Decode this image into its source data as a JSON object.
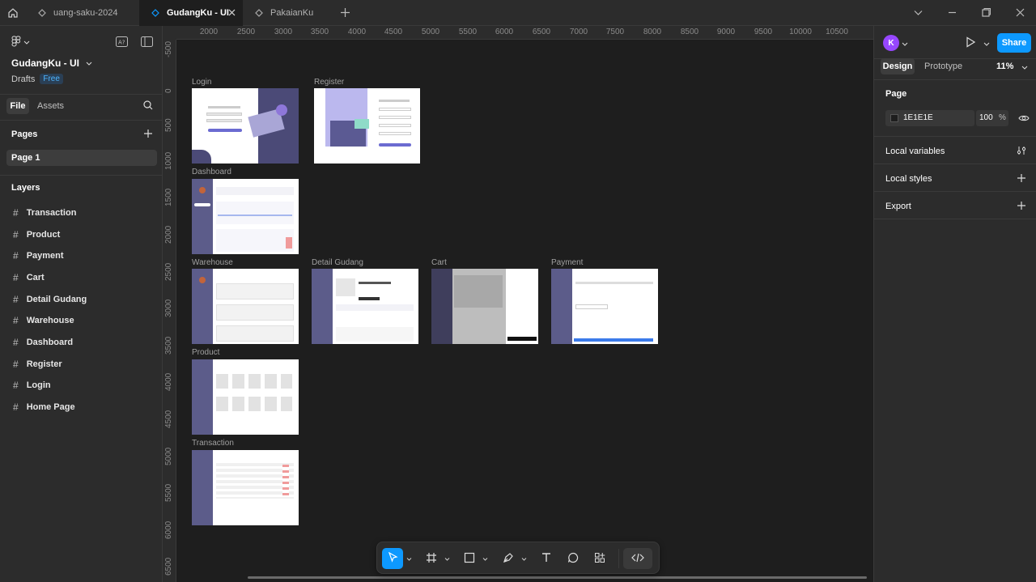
{
  "tabs": [
    {
      "title": "uang-saku-2024",
      "active": false
    },
    {
      "title": "GudangKu - UI",
      "active": true
    },
    {
      "title": "PakaianKu",
      "active": false
    }
  ],
  "left": {
    "file_name": "GudangKu - UI",
    "location": "Drafts",
    "plan_badge": "Free",
    "file_tab": "File",
    "assets_tab": "Assets",
    "pages_heading": "Pages",
    "current_page": "Page 1",
    "layers_heading": "Layers",
    "layers": [
      "Transaction",
      "Product",
      "Payment",
      "Cart",
      "Detail Gudang",
      "Warehouse",
      "Dashboard",
      "Register",
      "Login",
      "Home Page"
    ]
  },
  "ruler": {
    "top": [
      "2000",
      "2500",
      "3000",
      "3500",
      "4000",
      "4500",
      "5000",
      "5500",
      "6000",
      "6500",
      "7000",
      "7500",
      "8000",
      "8500",
      "9000",
      "9500",
      "10000",
      "10500"
    ],
    "left": [
      "-500",
      "0",
      "500",
      "1000",
      "1500",
      "2000",
      "2500",
      "3000",
      "3500",
      "4000",
      "4500",
      "5000",
      "5500",
      "6000",
      "6500"
    ]
  },
  "frames": {
    "login": "Login",
    "register": "Register",
    "dashboard": "Dashboard",
    "warehouse": "Warehouse",
    "detail_gudang": "Detail Gudang",
    "cart": "Cart",
    "payment": "Payment",
    "product": "Product",
    "transaction": "Transaction"
  },
  "right": {
    "avatar_letter": "K",
    "share_label": "Share",
    "design_tab": "Design",
    "prototype_tab": "Prototype",
    "zoom": "11%",
    "page_heading": "Page",
    "bg_color_hex": "1E1E1E",
    "bg_opacity": "100",
    "opacity_unit": "%",
    "local_variables": "Local variables",
    "local_styles": "Local styles",
    "export": "Export"
  },
  "colors": {
    "accent": "#0d99ff",
    "avatar": "#9747ff",
    "canvas": "#1e1e1e",
    "panel": "#2c2c2c",
    "sidebar_purple": "#4b4a77"
  },
  "help": "?"
}
